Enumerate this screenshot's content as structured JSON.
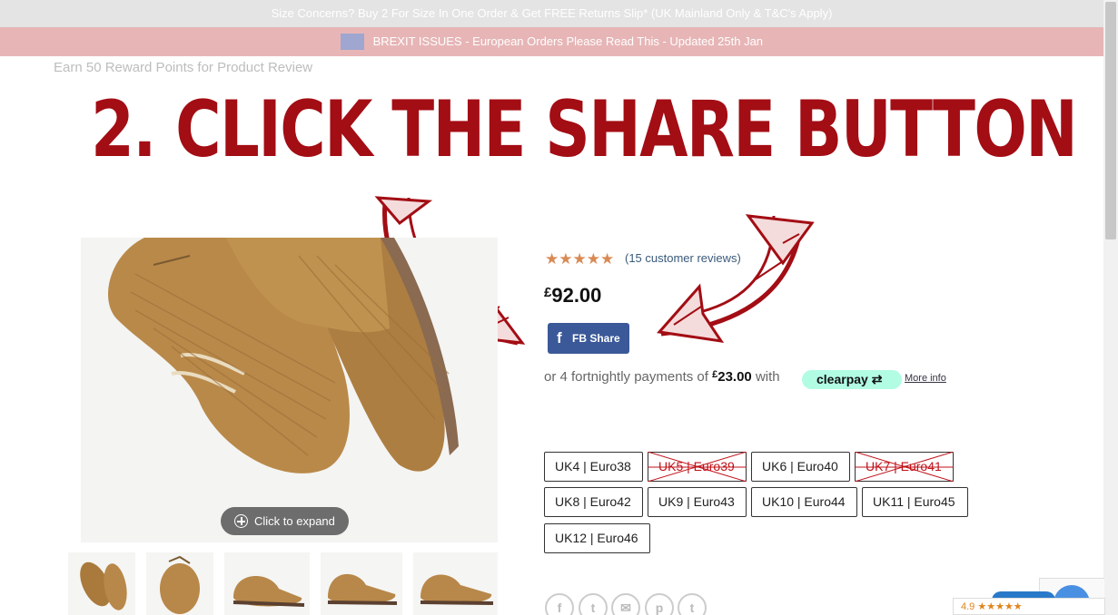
{
  "banners": {
    "size_concerns": "Size Concerns? Buy 2 For Size In One Order & Get FREE Returns Slip* (UK Mainland Only & T&C's Apply)",
    "brexit": "BREXIT ISSUES - European Orders Please Read This - Updated 25th Jan"
  },
  "earn_points": "Earn 50 Reward Points for Product Review",
  "headline": "2. CLICK THE SHARE BUTTON",
  "gallery": {
    "expand_label": "Click to expand",
    "thumb_count": 5
  },
  "product": {
    "stars": "★★★★★",
    "rating": 5,
    "reviews_label": "(15 customer reviews)",
    "currency": "£",
    "price": "92.00",
    "share_button": "FB Share",
    "share_icon": "facebook-f",
    "installments_prefix": "or 4 fortnightly payments of",
    "installment_amount": "23.00",
    "installments_suffix": "with",
    "clearpay_label": "clearpay",
    "more_info": "More info"
  },
  "sizes": [
    {
      "label": "UK4 | Euro38",
      "available": true
    },
    {
      "label": "UK5 | Euro39",
      "available": false
    },
    {
      "label": "UK6 | Euro40",
      "available": true
    },
    {
      "label": "UK7 | Euro41",
      "available": false
    },
    {
      "label": "UK8 | Euro42",
      "available": true
    },
    {
      "label": "UK9 | Euro43",
      "available": true
    },
    {
      "label": "UK10 | Euro44",
      "available": true
    },
    {
      "label": "UK11 | Euro45",
      "available": true
    },
    {
      "label": "UK12 | Euro46",
      "available": true
    }
  ],
  "social_icons": [
    "facebook-icon",
    "twitter-icon",
    "email-icon",
    "pinterest-icon",
    "tumblr-icon"
  ],
  "social_glyphs": [
    "f",
    "t",
    "✉",
    "p",
    "t"
  ],
  "review_badge": {
    "score": "4.9",
    "stars": "★★★★★"
  },
  "colors": {
    "headline_red": "#a30d14",
    "brexit_bar": "#e7b5b6",
    "facebook_blue": "#3b5998",
    "clearpay_mint": "#b2fce4",
    "star_orange": "#d98a54"
  }
}
